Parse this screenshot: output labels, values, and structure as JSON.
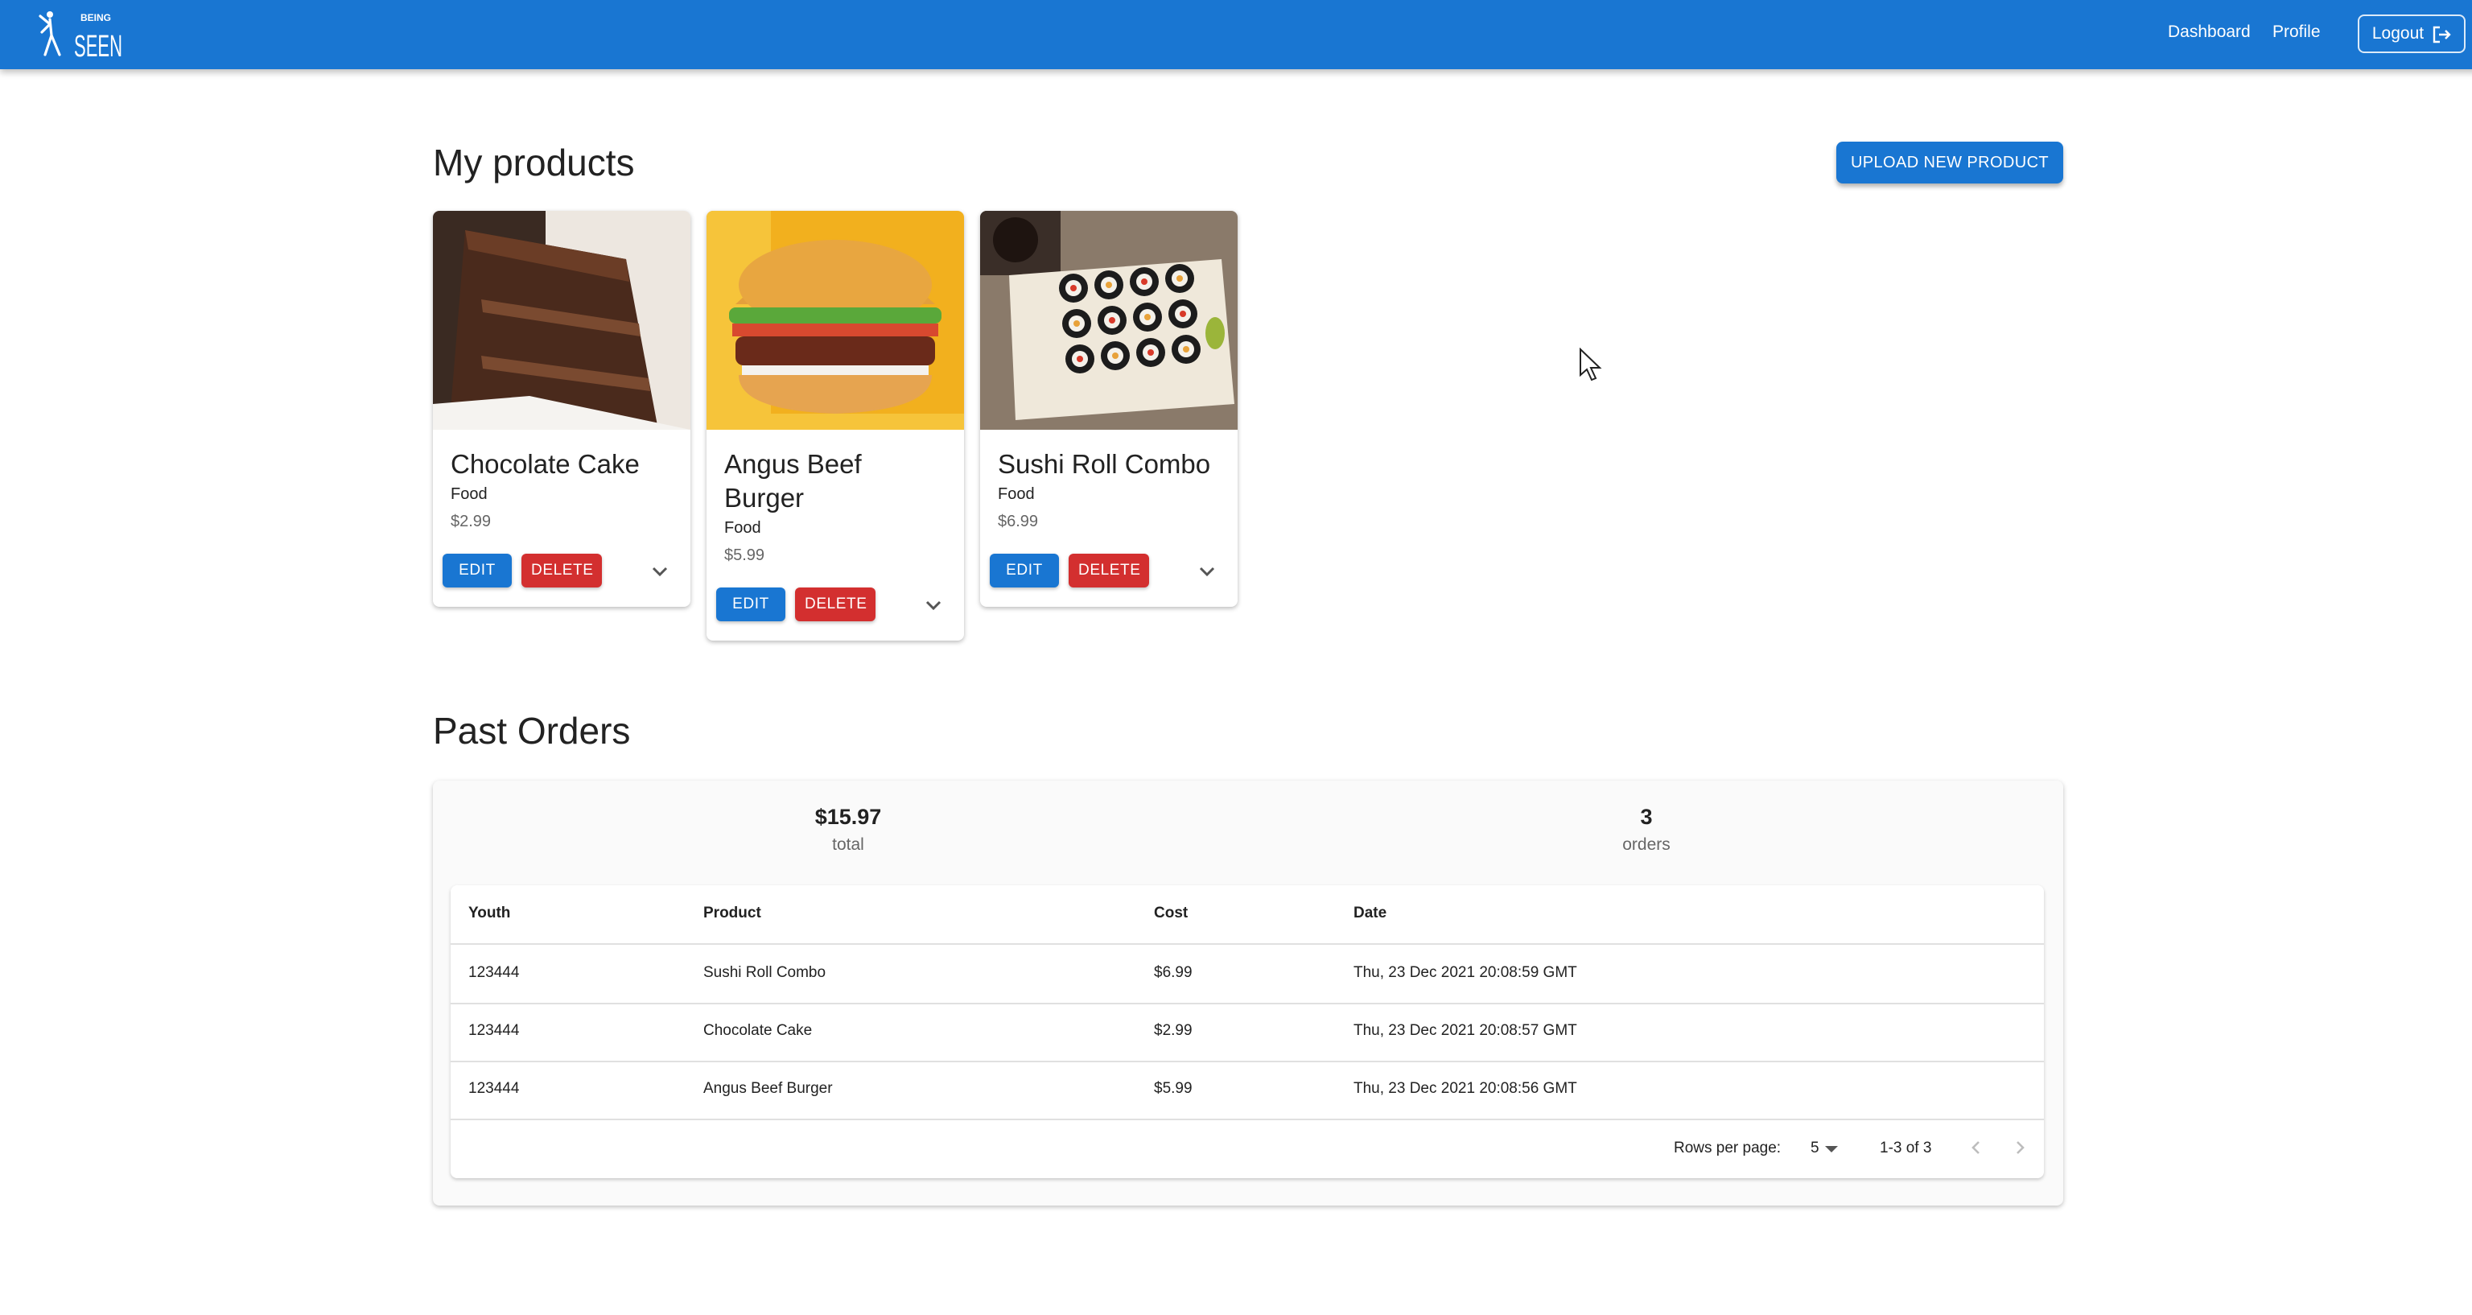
{
  "nav": {
    "logo_small": "BEING",
    "logo_big": "SEEN",
    "dashboard": "Dashboard",
    "profile": "Profile",
    "logout": "Logout"
  },
  "products": {
    "heading": "My products",
    "upload_label": "UPLOAD NEW PRODUCT",
    "edit_label": "EDIT",
    "delete_label": "DELETE",
    "items": [
      {
        "name": "Chocolate Cake",
        "category": "Food",
        "price": "$2.99"
      },
      {
        "name": "Angus Beef Burger",
        "category": "Food",
        "price": "$5.99"
      },
      {
        "name": "Sushi Roll Combo",
        "category": "Food",
        "price": "$6.99"
      }
    ]
  },
  "orders": {
    "heading": "Past Orders",
    "total_value": "$15.97",
    "total_label": "total",
    "count_value": "3",
    "count_label": "orders",
    "columns": [
      "Youth",
      "Product",
      "Cost",
      "Date"
    ],
    "rows": [
      [
        "123444",
        "Sushi Roll Combo",
        "$6.99",
        "Thu, 23 Dec 2021 20:08:59 GMT"
      ],
      [
        "123444",
        "Chocolate Cake",
        "$2.99",
        "Thu, 23 Dec 2021 20:08:57 GMT"
      ],
      [
        "123444",
        "Angus Beef Burger",
        "$5.99",
        "Thu, 23 Dec 2021 20:08:56 GMT"
      ]
    ],
    "rows_per_page_label": "Rows per page:",
    "rows_per_page_value": "5",
    "range_label": "1-3 of 3"
  },
  "colors": {
    "primary": "#1976d2",
    "danger": "#d32f2f"
  }
}
